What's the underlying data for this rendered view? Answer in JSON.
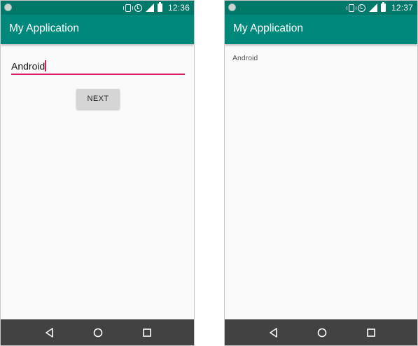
{
  "screens": [
    {
      "status_time": "12:36",
      "app_title": "My Application",
      "edit_text_value": "Android",
      "next_button_label": "NEXT"
    },
    {
      "status_time": "12:37",
      "app_title": "My Application",
      "result_text": "Android"
    }
  ],
  "colors": {
    "status_bar": "#00796b",
    "app_bar": "#00897b",
    "accent": "#d81b60",
    "nav_bar": "#424242",
    "background": "#fafafa"
  },
  "icons": {
    "status": [
      "vibrate-icon",
      "alarm-icon",
      "signal-icon",
      "battery-charging-icon"
    ],
    "navigation": [
      "back-icon",
      "home-icon",
      "recent-apps-icon"
    ]
  }
}
